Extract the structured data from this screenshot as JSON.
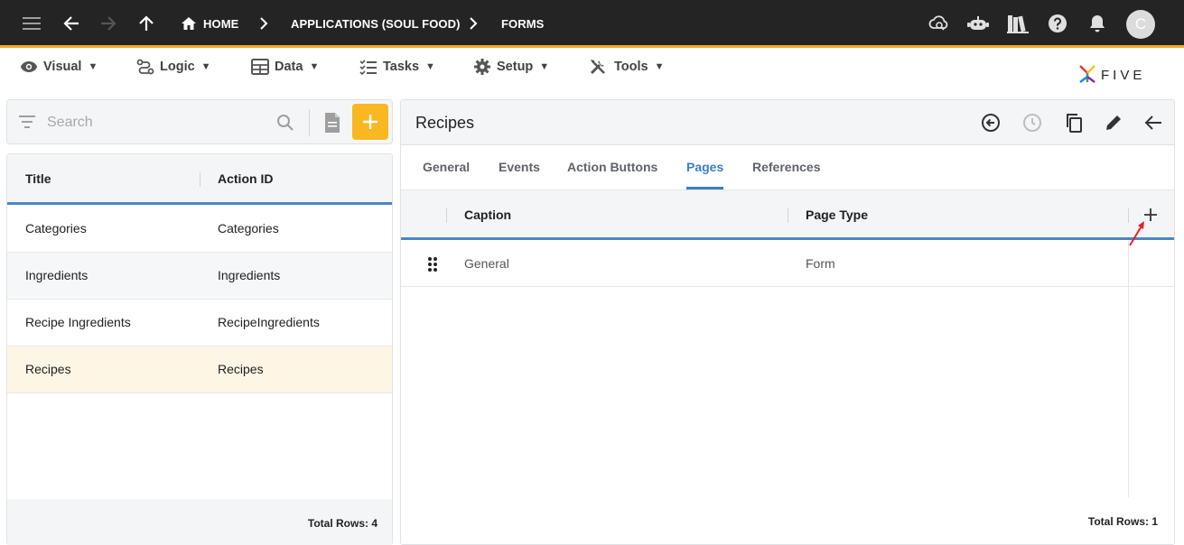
{
  "topbar": {
    "breadcrumbs": [
      "HOME",
      "APPLICATIONS (SOUL FOOD)",
      "FORMS"
    ],
    "avatar_initial": "C",
    "bg_color": "#242424",
    "accent_color": "#f5a623"
  },
  "menu": {
    "items": [
      {
        "label": "Visual",
        "icon": "eye-icon"
      },
      {
        "label": "Logic",
        "icon": "logic-icon"
      },
      {
        "label": "Data",
        "icon": "table-icon"
      },
      {
        "label": "Tasks",
        "icon": "tasks-icon"
      },
      {
        "label": "Setup",
        "icon": "gear-icon"
      },
      {
        "label": "Tools",
        "icon": "tools-icon"
      }
    ],
    "caret": "▼",
    "logo_text": "FIVE"
  },
  "left": {
    "search_placeholder": "Search",
    "columns": [
      "Title",
      "Action ID"
    ],
    "rows": [
      {
        "title": "Categories",
        "action_id": "Categories"
      },
      {
        "title": "Ingredients",
        "action_id": "Ingredients"
      },
      {
        "title": "Recipe Ingredients",
        "action_id": "RecipeIngredients"
      },
      {
        "title": "Recipes",
        "action_id": "Recipes",
        "selected": true
      }
    ],
    "total_rows": "Total Rows: 4"
  },
  "right": {
    "title": "Recipes",
    "tabs": [
      "General",
      "Events",
      "Action Buttons",
      "Pages",
      "References"
    ],
    "active_tab": "Pages",
    "columns": [
      "Caption",
      "Page Type"
    ],
    "rows": [
      {
        "caption": "General",
        "page_type": "Form"
      }
    ],
    "total_rows": "Total Rows: 1"
  },
  "colors": {
    "active_tab": "#3b7ec3",
    "add_button": "#f9b822",
    "selected_row": "#fef6e4",
    "annotation_arrow": "#e8202a"
  }
}
